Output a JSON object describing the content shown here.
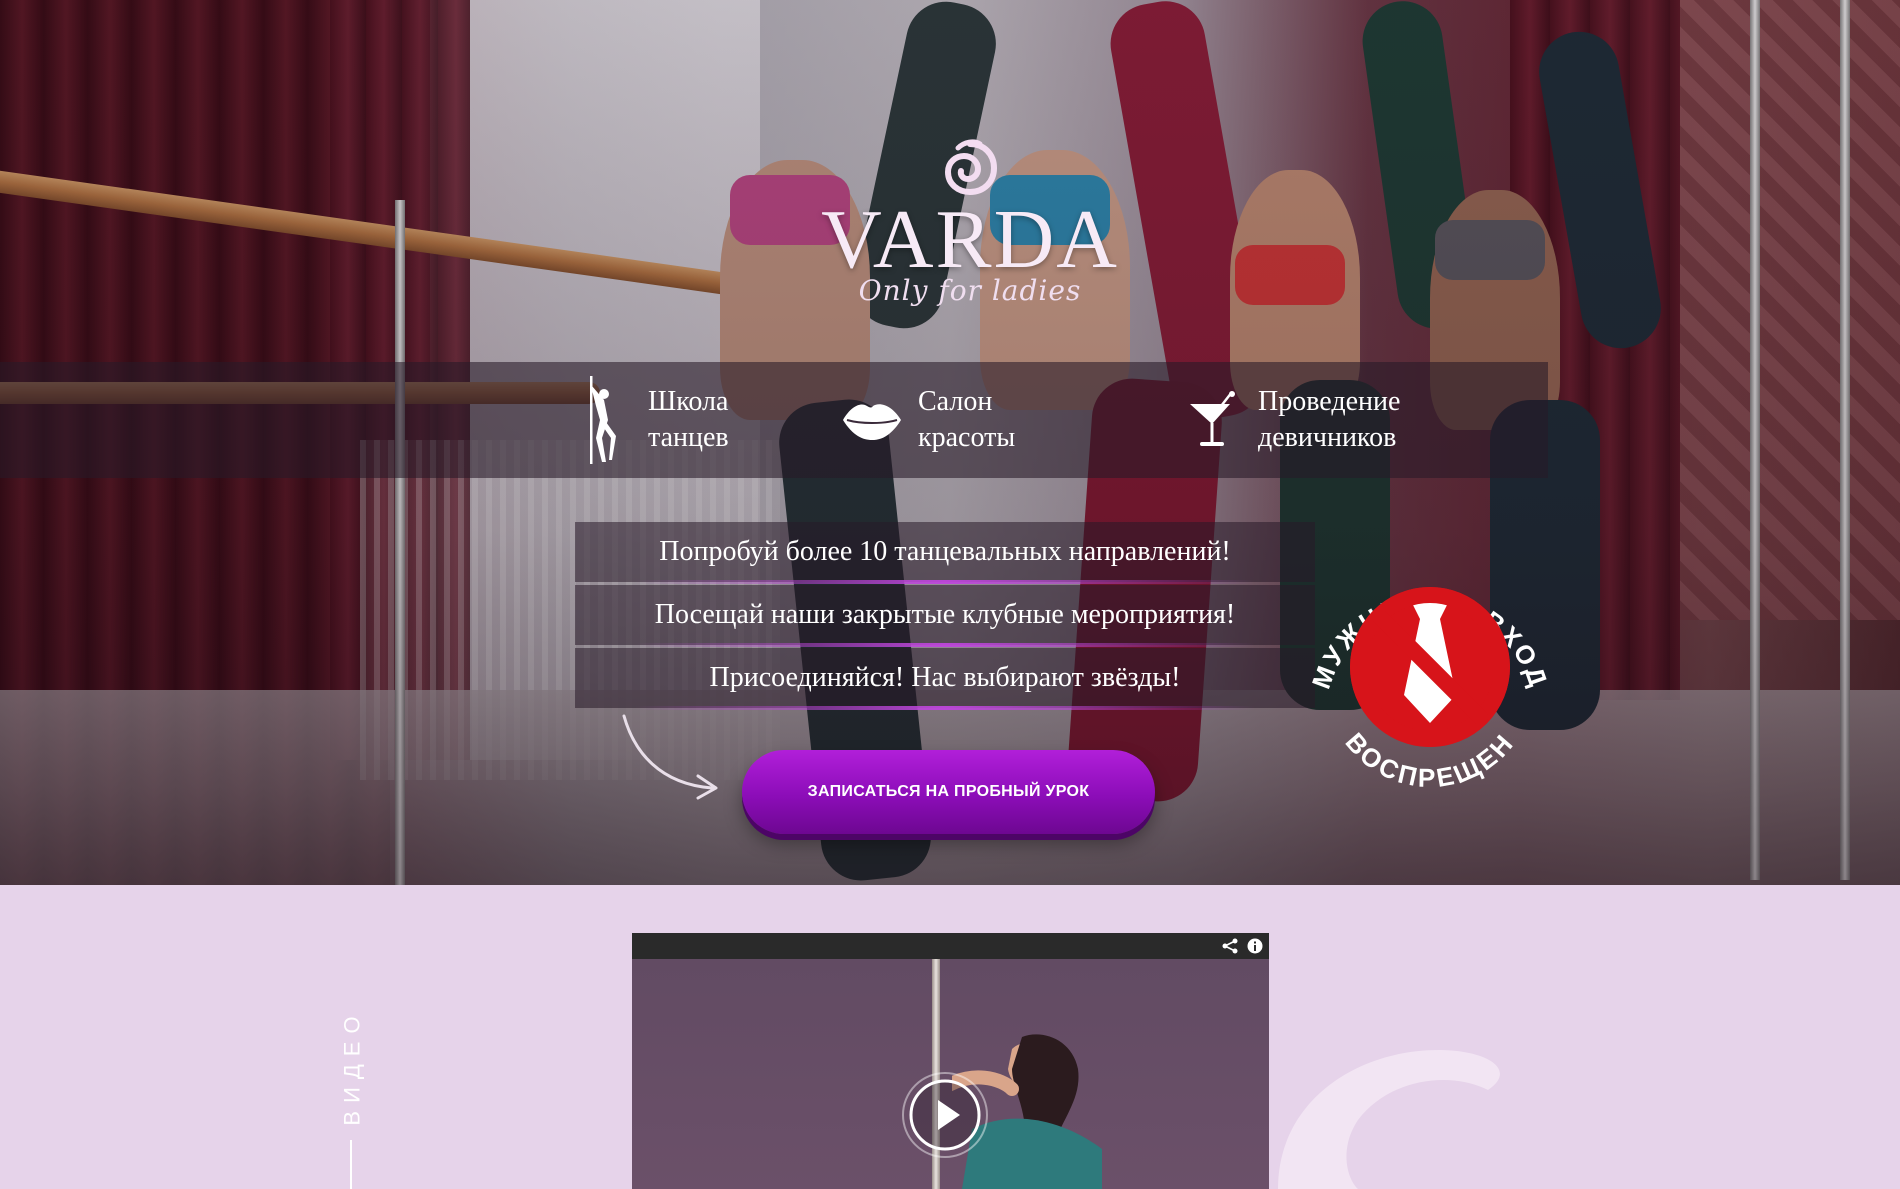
{
  "brand": {
    "name": "VARDA",
    "tagline": "Only for ladies"
  },
  "services": [
    {
      "label_line1": "Школа",
      "label_line2": "танцев",
      "icon": "pole-dancer-icon"
    },
    {
      "label_line1": "Салон",
      "label_line2": "красоты",
      "icon": "lips-icon"
    },
    {
      "label_line1": "Проведение",
      "label_line2": "девичников",
      "icon": "cocktail-icon"
    }
  ],
  "promo": [
    "Попробуй более 10 танцевальных направлений!",
    "Посещай наши закрытые клубные мероприятия!",
    "Присоединяйся! Нас выбирают звёзды!"
  ],
  "cta": {
    "label": "ЗАПИСАТЬСЯ НА ПРОБНЫЙ УРОК"
  },
  "badge": {
    "top_text": "МУЖЧИНАМ ВХОД",
    "bottom_text": "ВОСПРЕЩЕН",
    "icon": "no-tie-icon"
  },
  "video_section": {
    "label": "ВИДЕО",
    "player_controls": [
      "share-icon",
      "info-icon",
      "play-icon"
    ]
  },
  "colors": {
    "accent_purple": "#8c0db8",
    "section_bg": "#e6d3ea",
    "badge_red": "#d7141a",
    "logo_pink": "#f7eaf6"
  }
}
